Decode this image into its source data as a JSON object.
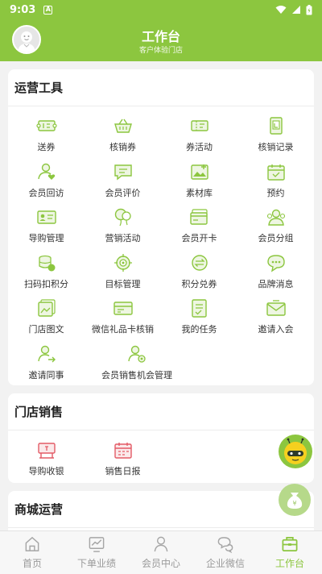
{
  "status_bar": {
    "time": "9:03",
    "badge": "A"
  },
  "header": {
    "title": "工作台",
    "subtitle": "客户体验门店"
  },
  "accent_color": "#8cc63f",
  "sections": {
    "operation_tools": {
      "title": "运营工具",
      "items": [
        {
          "label": "送券",
          "icon": "ticket-icon"
        },
        {
          "label": "核销券",
          "icon": "basket-icon"
        },
        {
          "label": "券活动",
          "icon": "ticket-activity-icon"
        },
        {
          "label": "核销记录",
          "icon": "record-icon"
        },
        {
          "label": "会员回访",
          "icon": "member-heart-icon"
        },
        {
          "label": "会员评价",
          "icon": "comment-icon"
        },
        {
          "label": "素材库",
          "icon": "image-library-icon"
        },
        {
          "label": "预约",
          "icon": "calendar-icon"
        },
        {
          "label": "导购管理",
          "icon": "id-card-icon"
        },
        {
          "label": "营销活动",
          "icon": "balloon-icon"
        },
        {
          "label": "会员开卡",
          "icon": "card-icon"
        },
        {
          "label": "会员分组",
          "icon": "group-icon"
        },
        {
          "label": "扫码扣积分",
          "icon": "coins-icon"
        },
        {
          "label": "目标管理",
          "icon": "target-icon"
        },
        {
          "label": "积分兑券",
          "icon": "exchange-icon"
        },
        {
          "label": "品牌消息",
          "icon": "chat-bubble-icon"
        },
        {
          "label": "门店图文",
          "icon": "gallery-icon"
        },
        {
          "label": "微信礼品卡核销",
          "icon": "gift-card-icon"
        },
        {
          "label": "我的任务",
          "icon": "task-icon"
        },
        {
          "label": "邀请入会",
          "icon": "envelope-icon"
        },
        {
          "label": "邀请同事",
          "icon": "invite-user-icon"
        },
        {
          "label": "会员销售机会管理",
          "icon": "member-gear-icon"
        }
      ]
    },
    "store_sales": {
      "title": "门店销售",
      "items": [
        {
          "label": "导购收银",
          "icon": "cashier-icon"
        },
        {
          "label": "销售日报",
          "icon": "daily-report-icon"
        }
      ]
    },
    "mall_operation": {
      "title": "商城运营"
    }
  },
  "tabs": [
    {
      "label": "首页",
      "icon": "home-icon",
      "active": false
    },
    {
      "label": "下单业绩",
      "icon": "chart-icon",
      "active": false
    },
    {
      "label": "会员中心",
      "icon": "user-icon",
      "active": false
    },
    {
      "label": "企业微信",
      "icon": "wechat-icon",
      "active": false
    },
    {
      "label": "工作台",
      "icon": "briefcase-icon",
      "active": true
    }
  ],
  "fab_money_symbol": "¥"
}
